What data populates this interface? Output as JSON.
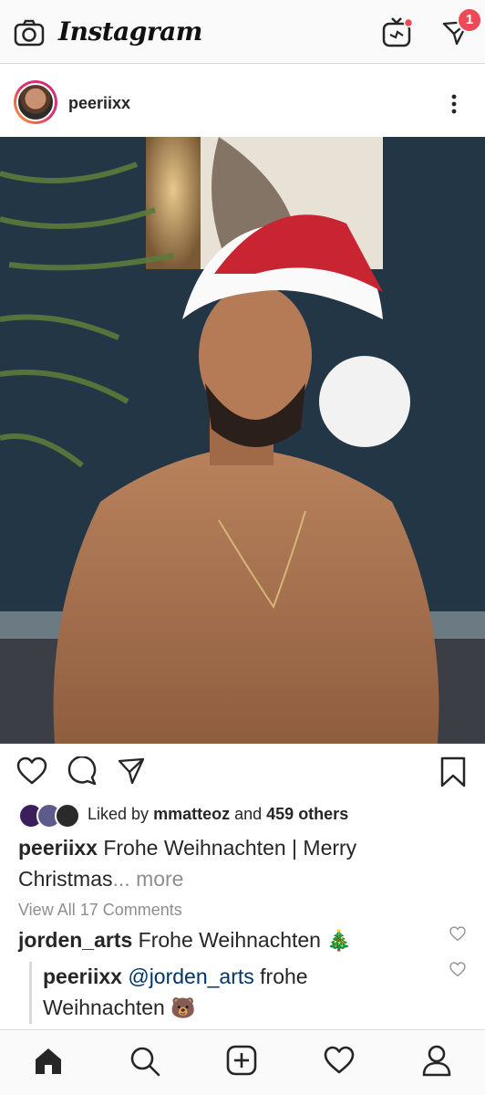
{
  "app": {
    "title": "Instagram"
  },
  "header": {
    "icons": [
      "camera-icon",
      "igtv-icon",
      "direct-message-icon"
    ],
    "dm_badge": "1"
  },
  "post": {
    "username": "peeriixx",
    "photo_alt": "peeriixx",
    "actions": [
      "like-heart-icon",
      "comment-icon",
      "share-icon",
      "save-bookmark-icon"
    ],
    "likes": {
      "prefix": "Liked by",
      "user": "mmatteoz",
      "connector": "and",
      "others": "459 others"
    },
    "caption": {
      "user": "peeriixx",
      "text": "Frohe Weihnachten | Merry Christmas",
      "more": "... more"
    },
    "view_all": "View All 17 Comments",
    "comments": [
      {
        "user": "jorden_arts",
        "text": "Frohe Weihnachten",
        "emoji": "🎄"
      },
      {
        "user": "peeriixx",
        "mention": "@jorden_arts",
        "text": "frohe Weihnachten",
        "emoji": "🐻"
      }
    ]
  },
  "bottom_nav": [
    "home-icon",
    "search-icon",
    "new-post-icon",
    "activity-heart-icon",
    "profile-icon"
  ],
  "colors": {
    "badge": "#ed4956",
    "mention": "#003569",
    "muted": "#8e8e8e"
  }
}
